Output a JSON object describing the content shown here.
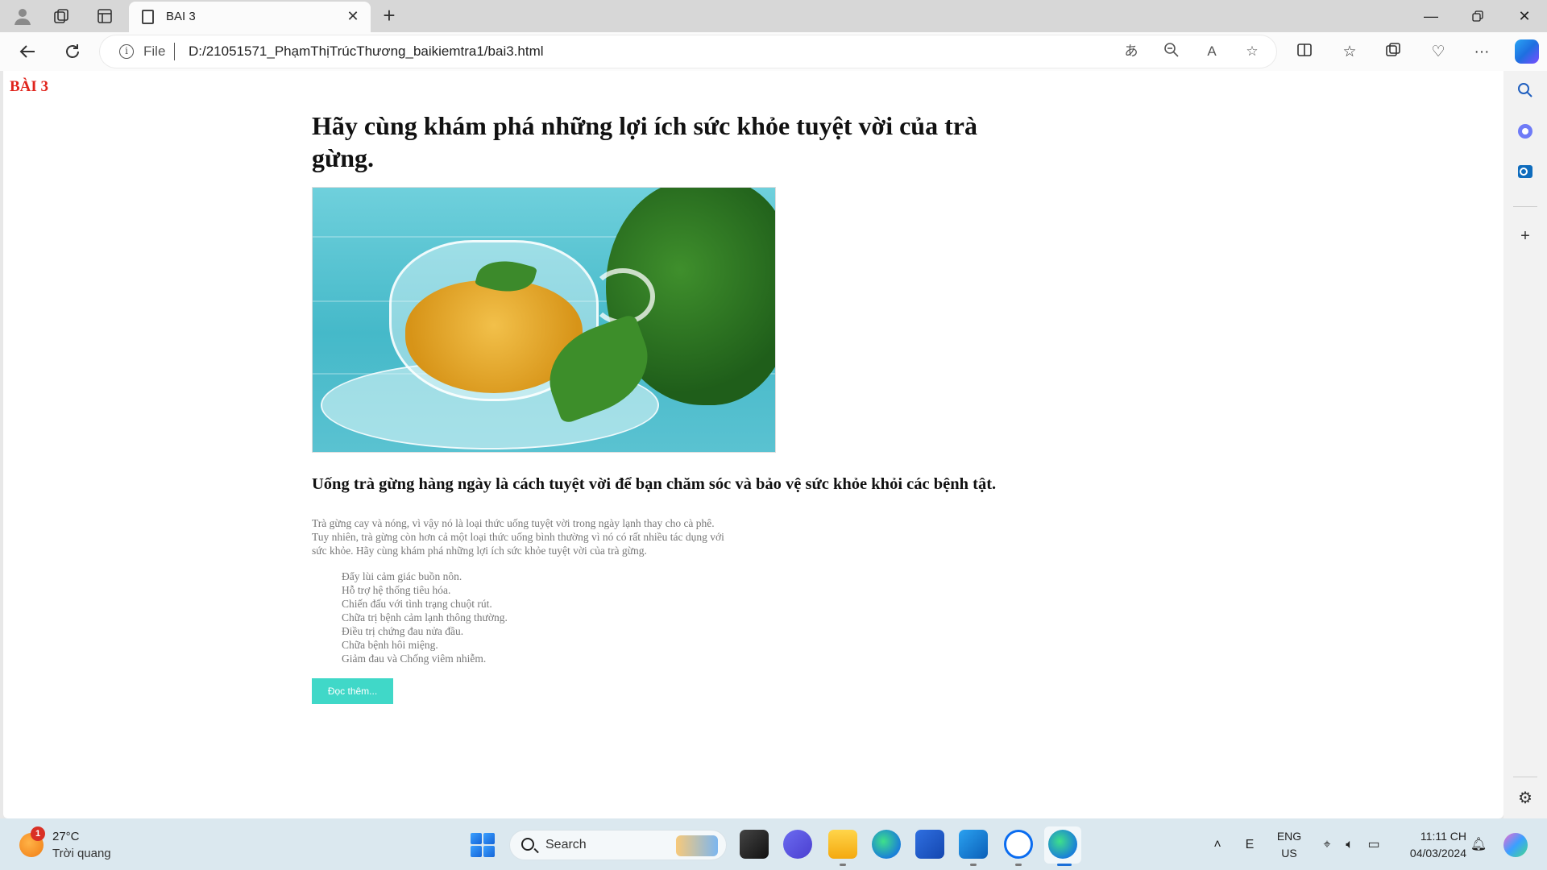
{
  "browser": {
    "tab_title": "BAI 3",
    "address_file_label": "File",
    "url": "D:/21051571_PhạmThịTrúcThương_baikiemtra1/bai3.html"
  },
  "page": {
    "label": "BÀI 3",
    "heading": "Hãy cùng khám phá những lợi ích sức khỏe tuyệt vời của trà gừng.",
    "subheading": "Uống trà gừng hàng ngày là cách tuyệt vời để bạn chăm sóc và bảo vệ sức khỏe khỏi các bệnh tật.",
    "intro_lines": [
      "Trà gừng cay và nóng, vì vậy nó là loại thức uống tuyệt vời trong ngày lạnh thay cho cà phê.",
      "Tuy nhiên, trà gừng còn hơn cả một loại thức uống bình thường vì nó có rất nhiều tác dụng với",
      "sức khỏe. Hãy cùng khám phá những lợi ích sức khỏe tuyệt vời của trà gừng."
    ],
    "benefits": [
      "Đẩy lùi cảm giác buồn nôn.",
      "Hỗ trợ hệ thống tiêu hóa.",
      "Chiến đấu với tình trạng chuột rút.",
      "Chữa trị bệnh cảm lạnh thông thường.",
      "Điều trị chứng đau nửa đầu.",
      "Chữa bệnh hôi miệng.",
      "Giảm đau và Chống viêm nhiễm."
    ],
    "read_more_label": "Đọc thêm..."
  },
  "taskbar": {
    "weather_badge": "1",
    "weather_temp": "27°C",
    "weather_desc": "Trời quang",
    "search_label": "Search",
    "lang_top": "ENG",
    "lang_bottom": "US",
    "time": "11:11 CH",
    "date": "04/03/2024"
  },
  "colors": {
    "page_label": "#e0241c",
    "read_more_button": "#40d8c8",
    "body_text": "#777777"
  }
}
